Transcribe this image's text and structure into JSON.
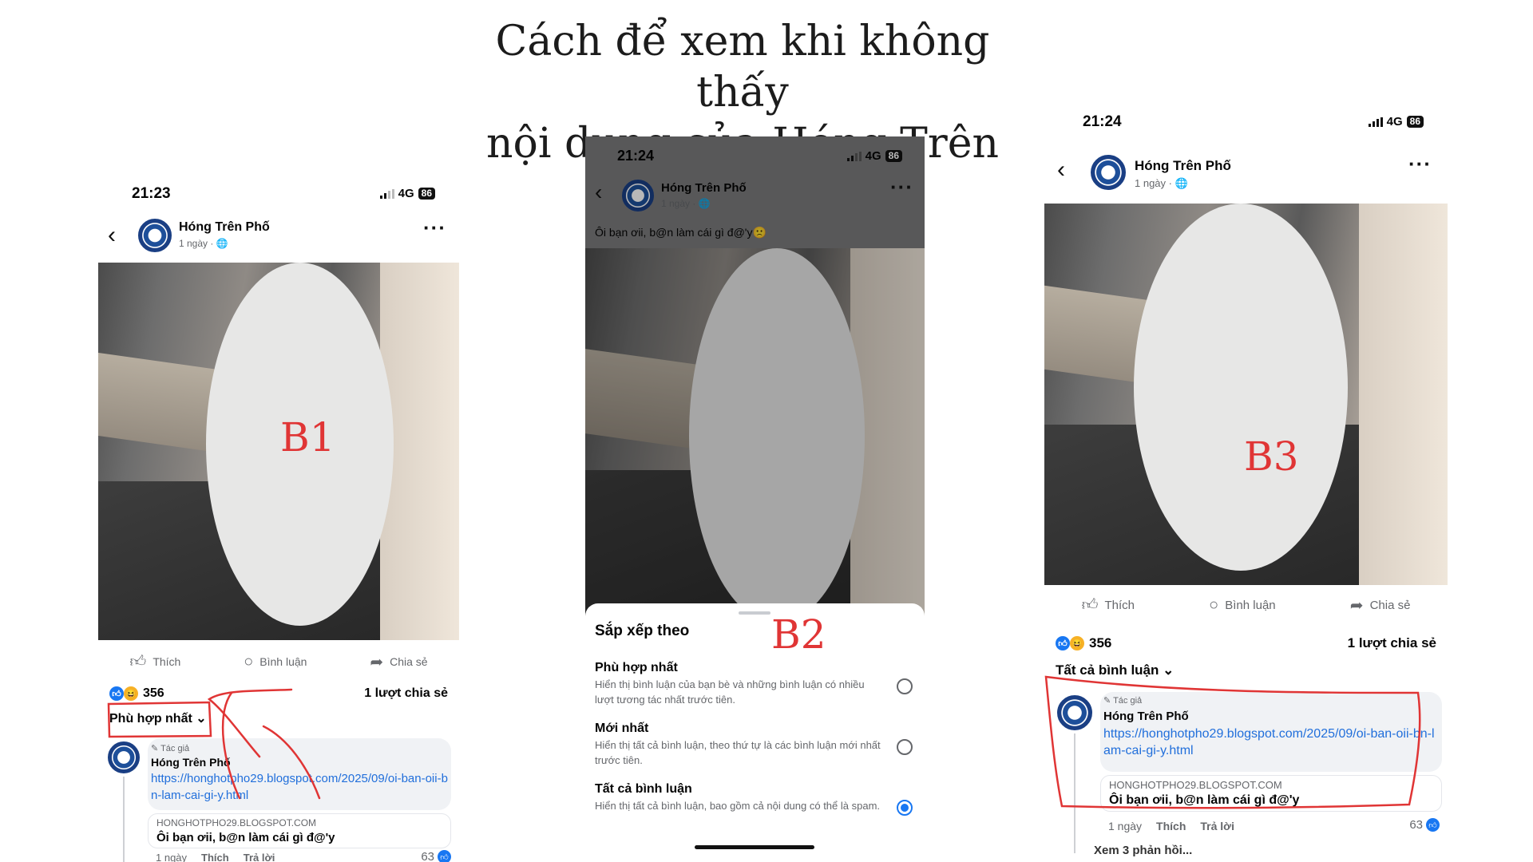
{
  "headline": {
    "line1": "Cách để xem khi không thấy",
    "line2": "nội dung của Hóng Trên Phố"
  },
  "steps": {
    "b1": "B1",
    "b2": "B2",
    "b3": "B3"
  },
  "post": {
    "page_name": "Hóng Trên Phố",
    "age": "1 ngày",
    "caption": "Ôi bạn ơii, b@n làm cái gì đ@'y🙁",
    "reactions": "356",
    "shares": "1 lượt chia sẻ",
    "actions": {
      "like": "Thích",
      "comment": "Bình luận",
      "share": "Chia sẻ"
    }
  },
  "phone1": {
    "time": "21:23",
    "network": "4G",
    "battery": "86",
    "sort_label": "Phù hợp nhất"
  },
  "phone2": {
    "time": "21:24",
    "network": "4G",
    "battery": "86",
    "sheet": {
      "title": "Sắp xếp theo",
      "options": [
        {
          "title": "Phù hợp nhất",
          "desc": "Hiển thị bình luận của bạn bè và những bình luận có nhiều lượt tương tác nhất trước tiên.",
          "selected": false
        },
        {
          "title": "Mới nhất",
          "desc": "Hiển thị tất cả bình luận, theo thứ tự là các bình luận mới nhất trước tiên.",
          "selected": false
        },
        {
          "title": "Tất cả bình luận",
          "desc": "Hiển thị tất cả bình luận, bao gồm cả nội dung có thể là spam.",
          "selected": true
        }
      ]
    }
  },
  "phone3": {
    "time": "21:24",
    "network": "4G",
    "battery": "86",
    "sort_label": "Tất cả bình luận",
    "view_replies": "Xem 3 phản hồi..."
  },
  "comment": {
    "author_tag": "Tác giả",
    "name": "Hóng Trên Phố",
    "link": "https://honghotpho29.blogspot.com/2025/09/oi-ban-oii-bn-lam-cai-gi-y.html",
    "preview_domain": "HONGHOTPHO29.BLOGSPOT.COM",
    "preview_title": "Ôi bạn ơii, b@n làm cái gì đ@'y",
    "age": "1 ngày",
    "like": "Thích",
    "reply": "Trả lời",
    "likes": "63"
  },
  "colors": {
    "annotation_red": "#e03535",
    "link_blue": "#216fdb",
    "fb_blue": "#1877f2"
  },
  "icons": [
    "back-chevron-icon",
    "more-dots-icon",
    "globe-icon",
    "thumbs-up-icon",
    "comment-bubble-icon",
    "share-arrow-icon",
    "chevron-down-icon",
    "pencil-icon",
    "radio-icon"
  ]
}
